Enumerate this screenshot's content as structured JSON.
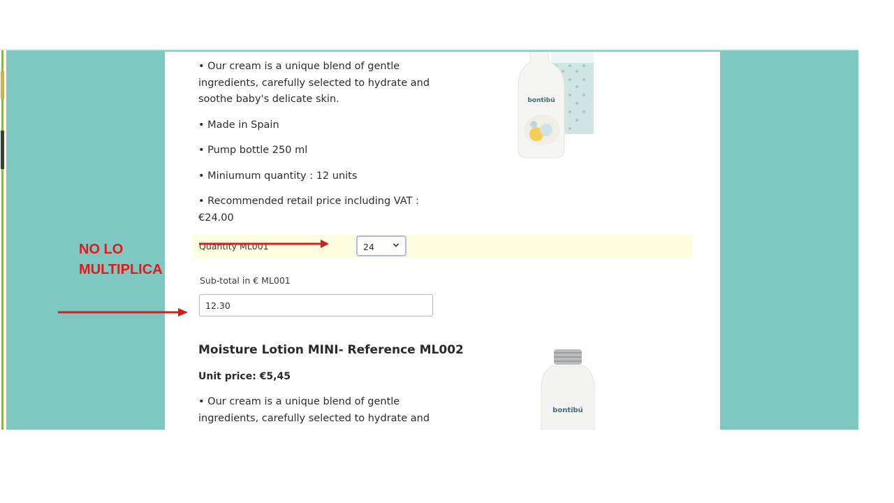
{
  "product1": {
    "bullets": [
      "• Our cream is a unique blend of gentle ingredients, carefully selected to hydrate and soothe baby's delicate skin.",
      "• Made in Spain",
      "• Pump bottle 250 ml",
      "• Miniumum quantity : 12 units",
      "• Recommended retail price including VAT : €24.00"
    ],
    "quantity_label": "Quantity ML001",
    "quantity_value": "24",
    "subtotal_label": "Sub-total in € ML001",
    "subtotal_value": "12.30",
    "image_brand": "bontibú"
  },
  "product2": {
    "title": "Moisture Lotion MINI- Reference ML002",
    "unit_price": "Unit price: €5,45",
    "bullet_partial": "• Our cream is a unique blend of gentle ingredients, carefully selected to hydrate and soothe baby's",
    "image_brand": "bontibú"
  },
  "annotation": {
    "line1": "NO LO",
    "line2": "MULTIPLICA"
  },
  "colors": {
    "page_bg": "#7fc8c2",
    "qty_row_bg": "#fdfde0",
    "annotation": "#e01b1b"
  },
  "icons": {
    "select_chevron": "chevron-down-icon"
  }
}
